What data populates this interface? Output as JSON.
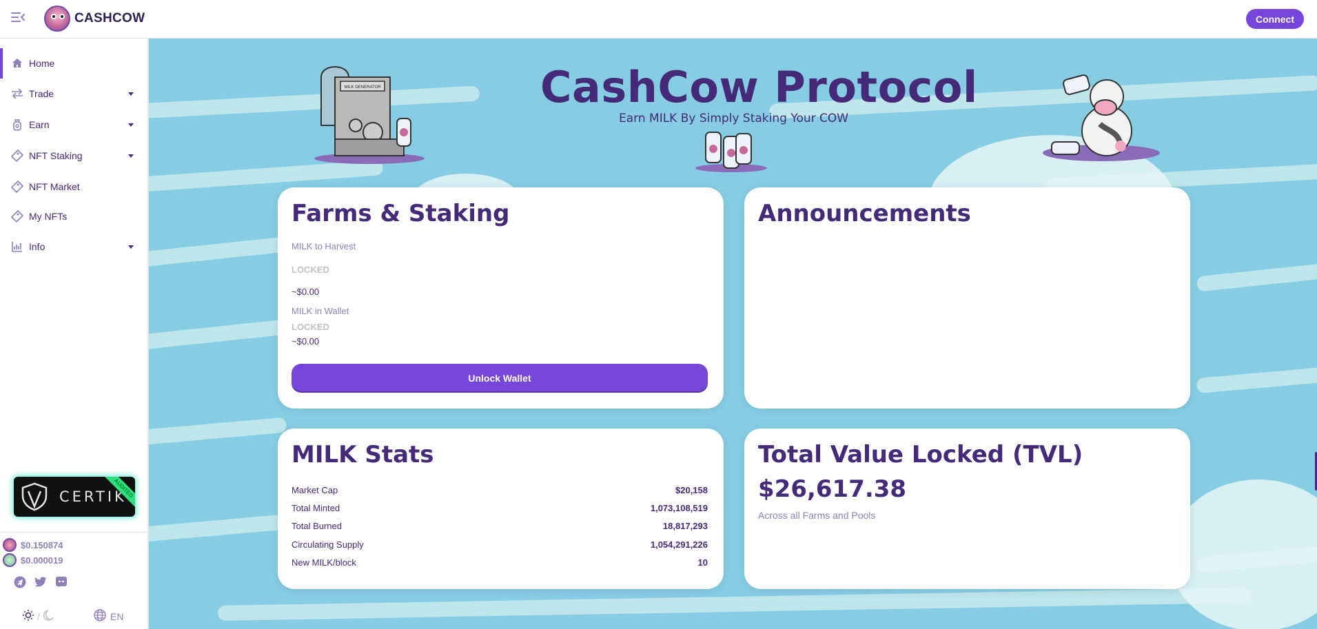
{
  "app": {
    "brand": "CASHCOW"
  },
  "header": {
    "connect_label": "Connect"
  },
  "sidebar": {
    "items": [
      {
        "label": "Home",
        "icon": "home-icon",
        "active": true,
        "has_children": false
      },
      {
        "label": "Trade",
        "icon": "swap-arrows-icon",
        "active": false,
        "has_children": true
      },
      {
        "label": "Earn",
        "icon": "money-bag-icon",
        "active": false,
        "has_children": true
      },
      {
        "label": "NFT Staking",
        "icon": "ticket-icon",
        "active": false,
        "has_children": true
      },
      {
        "label": "NFT Market",
        "icon": "ticket-icon",
        "active": false,
        "has_children": false
      },
      {
        "label": "My NFTs",
        "icon": "ticket-icon",
        "active": false,
        "has_children": false
      },
      {
        "label": "Info",
        "icon": "bar-chart-icon",
        "active": false,
        "has_children": true
      }
    ],
    "certik": {
      "label": "CERTIK",
      "ribbon": "AUDITED"
    },
    "prices": [
      {
        "value": "$0.150874",
        "coin_color": "#c46a9b"
      },
      {
        "value": "$0.000019",
        "coin_color": "#7fcfa8"
      }
    ],
    "theme_separator": "/",
    "language": "EN"
  },
  "hero": {
    "title": "CashCow Protocol",
    "subtitle": "Earn MILK By Simply Staking Your COW",
    "machine_label": "MILK GENERATOR"
  },
  "farms": {
    "title": "Farms & Staking",
    "harvest_label": "MILK to Harvest",
    "harvest_status": "LOCKED",
    "harvest_usd": "~$0.00",
    "wallet_label": "MILK in Wallet",
    "wallet_status": "LOCKED",
    "wallet_usd": "~$0.00",
    "unlock_label": "Unlock Wallet"
  },
  "announcements": {
    "title": "Announcements"
  },
  "milk_stats": {
    "title": "MILK Stats",
    "rows": [
      {
        "label": "Market Cap",
        "value": "$20,158"
      },
      {
        "label": "Total Minted",
        "value": "1,073,108,519"
      },
      {
        "label": "Total Burned",
        "value": "18,817,293"
      },
      {
        "label": "Circulating Supply",
        "value": "1,054,291,226"
      },
      {
        "label": "New MILK/block",
        "value": "10"
      }
    ]
  },
  "tvl": {
    "title": "Total Value Locked (TVL)",
    "value": "$26,617.38",
    "subtitle": "Across all Farms and Pools"
  },
  "colors": {
    "primary": "#7645d9",
    "text": "#452a7a",
    "text_subtle": "#8f80ba",
    "disabled": "#bdc2c4",
    "sky": "#86cde3"
  }
}
